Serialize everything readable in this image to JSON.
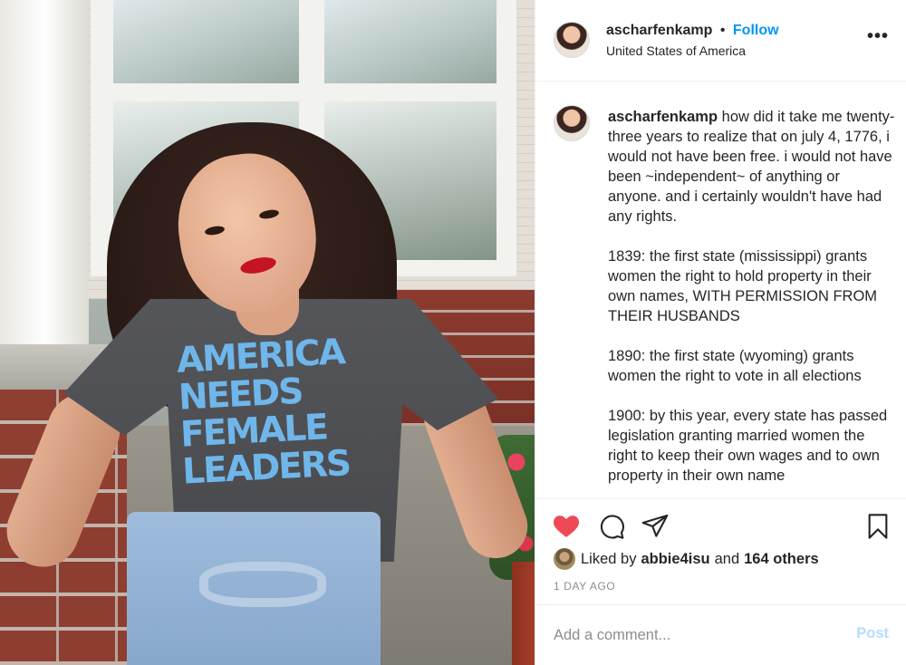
{
  "header": {
    "username": "ascharfenkamp",
    "separator": "•",
    "follow_label": "Follow",
    "location": "United States of America",
    "more_icon": "•••"
  },
  "photo": {
    "shirt_lines": [
      "AMERICA",
      "NEEDS",
      "FEMALE",
      "LEADERS"
    ]
  },
  "caption": {
    "username": "ascharfenkamp",
    "paragraphs": [
      "how did it take me twenty-three years to realize that on july 4, 1776, i would not have been free. i would not have been ~independent~ of anything or anyone. and i certainly wouldn't have had any rights.",
      "1839: the first state (mississippi) grants women the right to hold property in their own names, WITH PERMISSION FROM THEIR HUSBANDS",
      "1890: the first state (wyoming) grants women the right to vote in all elections",
      "1900: by this year, every state has passed legislation granting married women the right to keep their own wages and to own property in their own name"
    ]
  },
  "actions": {
    "heart_icon": "heart-filled",
    "comment_icon": "speech-bubble",
    "share_icon": "paper-plane",
    "save_icon": "bookmark",
    "heart_color": "#ed4956"
  },
  "likes": {
    "prefix": "Liked by",
    "liker": "abbie4isu",
    "conjunction": "and",
    "others": "164 others"
  },
  "timestamp": "1 DAY AGO",
  "comment": {
    "placeholder": "Add a comment...",
    "post_label": "Post",
    "post_color": "#b2dffc"
  }
}
